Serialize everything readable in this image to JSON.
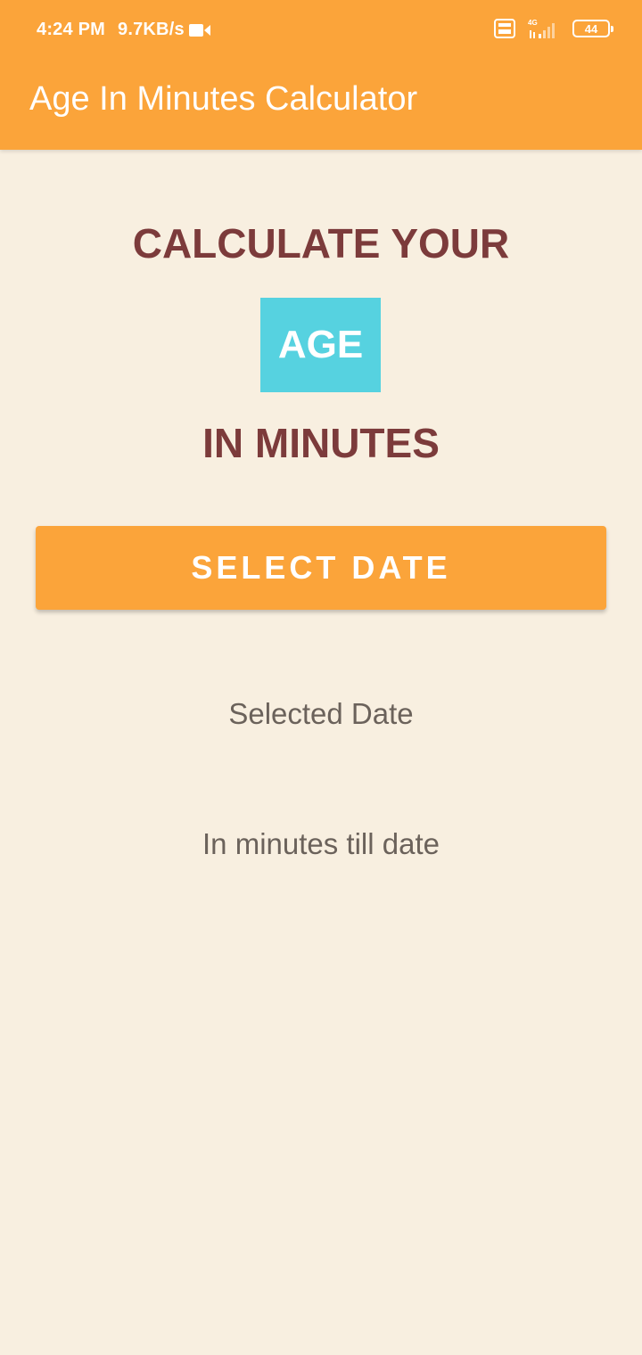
{
  "status_bar": {
    "time": "4:24 PM",
    "net_speed": "9.7KB/s",
    "video_icon": "video-camera-icon",
    "volte_icon": "volte-icon",
    "signal_icon": "signal-4g-icon",
    "network_type": "4G",
    "battery_level": "44"
  },
  "app_bar": {
    "title": "Age In Minutes Calculator",
    "color": "#fba43a"
  },
  "main": {
    "heading_line1": "CALCULATE YOUR",
    "heading_age": "AGE",
    "heading_line3": "IN MINUTES",
    "select_date_button": "SELECT DATE",
    "selected_date_text": "Selected Date",
    "minutes_text": "In minutes till date"
  },
  "colors": {
    "accent": "#fba43a",
    "background": "#f8efe0",
    "heading": "#7c3b3b",
    "age_box": "#56d2e0",
    "muted_text": "#6b625b"
  }
}
